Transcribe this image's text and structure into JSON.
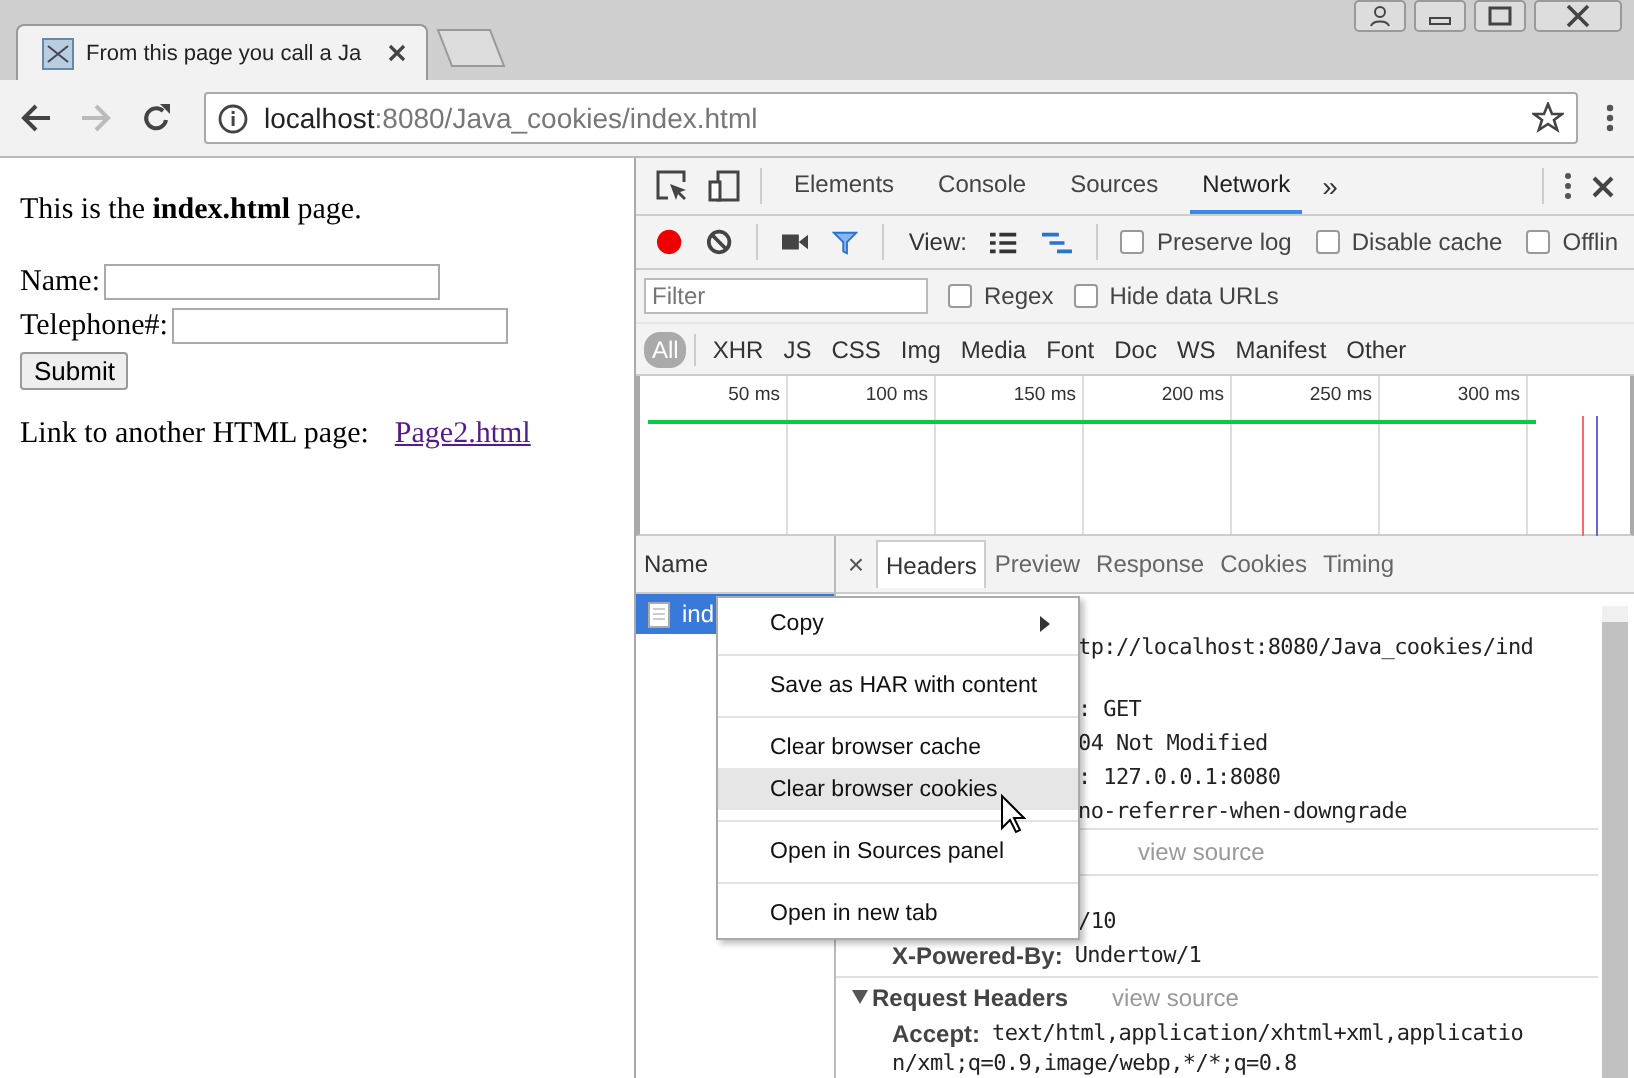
{
  "browser": {
    "tab_title": "From this page you call a Ja",
    "address": {
      "host": "localhost",
      "path": ":8080/Java_cookies/index.html"
    }
  },
  "page": {
    "intro": "This is the **index.html** page.",
    "fields": [
      {
        "label": "Name:"
      },
      {
        "label": "Telephone#:"
      }
    ],
    "submit": "Submit",
    "link_label": "Link to another HTML page:",
    "link": "Page2.html"
  },
  "devtools": {
    "tabs": [
      {
        "label": "Elements",
        "selected": false
      },
      {
        "label": "Console",
        "selected": false
      },
      {
        "label": "Sources",
        "selected": false
      },
      {
        "label": "Network",
        "selected": true
      }
    ],
    "overflow": "»",
    "view_label": "View:",
    "checkboxes": [
      {
        "label": "Preserve log",
        "checked": false
      },
      {
        "label": "Disable cache",
        "checked": false
      },
      {
        "label": "Offlin",
        "checked": false
      }
    ],
    "filter": {
      "placeholder": "Filter"
    },
    "filter_checkboxes": [
      {
        "label": "Regex",
        "checked": false
      },
      {
        "label": "Hide data URLs",
        "checked": false
      }
    ],
    "types": [
      {
        "label": "All",
        "selected": true
      },
      {
        "label": "XHR",
        "selected": false
      },
      {
        "label": "JS",
        "selected": false
      },
      {
        "label": "CSS",
        "selected": false
      },
      {
        "label": "Img",
        "selected": false
      },
      {
        "label": "Media",
        "selected": false
      },
      {
        "label": "Font",
        "selected": false
      },
      {
        "label": "Doc",
        "selected": false
      },
      {
        "label": "WS",
        "selected": false
      },
      {
        "label": "Manifest",
        "selected": false
      },
      {
        "label": "Other",
        "selected": false
      }
    ],
    "timeline_ticks": [
      "50 ms",
      "100 ms",
      "150 ms",
      "200 ms",
      "250 ms",
      "300 ms"
    ],
    "name_header": "Name",
    "requests": [
      {
        "name": "ind",
        "selected": true
      }
    ],
    "close_detail": "×",
    "detail_tabs": [
      {
        "label": "Headers",
        "selected": true
      },
      {
        "label": "Preview",
        "selected": false
      },
      {
        "label": "Response",
        "selected": false
      },
      {
        "label": "Cookies",
        "selected": false
      },
      {
        "label": "Timing",
        "selected": false
      }
    ],
    "headers": [
      {
        "kind": "value",
        "text": "tp://localhost:8080/Java_cookies/ind"
      },
      {
        "kind": "value",
        "text": ": GET"
      },
      {
        "kind": "value",
        "text": "04 Not Modified"
      },
      {
        "kind": "value",
        "text": ": 127.0.0.1:8080"
      },
      {
        "kind": "value",
        "text": "no-referrer-when-downgrade"
      },
      {
        "kind": "link",
        "text": "view source"
      },
      {
        "kind": "value",
        "text": "/10"
      },
      {
        "kind": "pair",
        "key": "X-Powered-By:",
        "text": "Undertow/1"
      },
      {
        "kind": "section",
        "key": "Request Headers",
        "text": "view source"
      },
      {
        "kind": "pair",
        "key": "Accept:",
        "text": "text/html,application/xhtml+xml,applicatio"
      },
      {
        "kind": "cont",
        "text": "n/xml;q=0.9,image/webp,*/*;q=0.8"
      }
    ]
  },
  "context_menu": [
    {
      "label": "Copy",
      "submenu": true,
      "selected": false,
      "divider_before": false
    },
    {
      "label": "Save as HAR with content",
      "submenu": false,
      "selected": false,
      "divider_before": true
    },
    {
      "label": "Clear browser cache",
      "submenu": false,
      "selected": false,
      "divider_before": true
    },
    {
      "label": "Clear browser cookies",
      "submenu": false,
      "selected": true,
      "divider_before": false
    },
    {
      "label": "Open in Sources panel",
      "submenu": false,
      "selected": false,
      "divider_before": true
    },
    {
      "label": "Open in new tab",
      "submenu": false,
      "selected": false,
      "divider_before": true
    }
  ]
}
